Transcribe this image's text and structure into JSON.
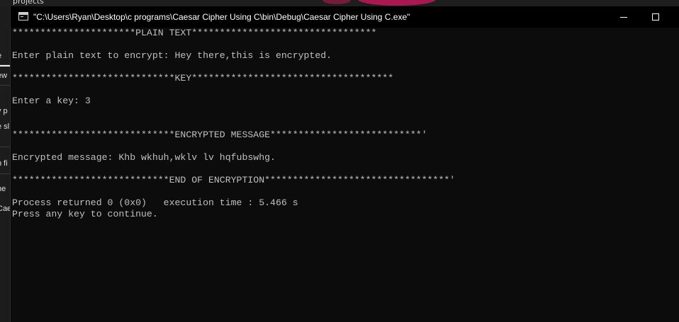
{
  "background": {
    "top_label": "projects",
    "left_items": [
      "e",
      "ew",
      "y p",
      "e sl",
      "n fi",
      "ne",
      "Cae"
    ]
  },
  "window": {
    "title": "\"C:\\Users\\Ryan\\Desktop\\c programs\\Caesar Cipher Using C\\bin\\Debug\\Caesar Cipher Using C.exe\"",
    "icon": "console-app-icon",
    "controls": {
      "minimize_icon": "minimize-icon",
      "maximize_icon": "maximize-icon"
    }
  },
  "console": {
    "lines": [
      "**********************PLAIN TEXT*********************************",
      "",
      "Enter plain text to encrypt: Hey there,this is encrypted.",
      "",
      "*****************************KEY************************************",
      "",
      "Enter a key: 3",
      "",
      "",
      "*****************************ENCRYPTED MESSAGE***************************'",
      "",
      "Encrypted message: Khb wkhuh,wklv lv hqfubswhg.",
      "",
      "****************************END OF ENCRYPTION*********************************'",
      "",
      "Process returned 0 (0x0)   execution time : 5.466 s",
      "Press any key to continue."
    ]
  },
  "colors": {
    "console_background": "#0c0c0c",
    "console_text": "#c0c0c0",
    "titlebar": "#000000",
    "title_text": "#ffffff"
  }
}
